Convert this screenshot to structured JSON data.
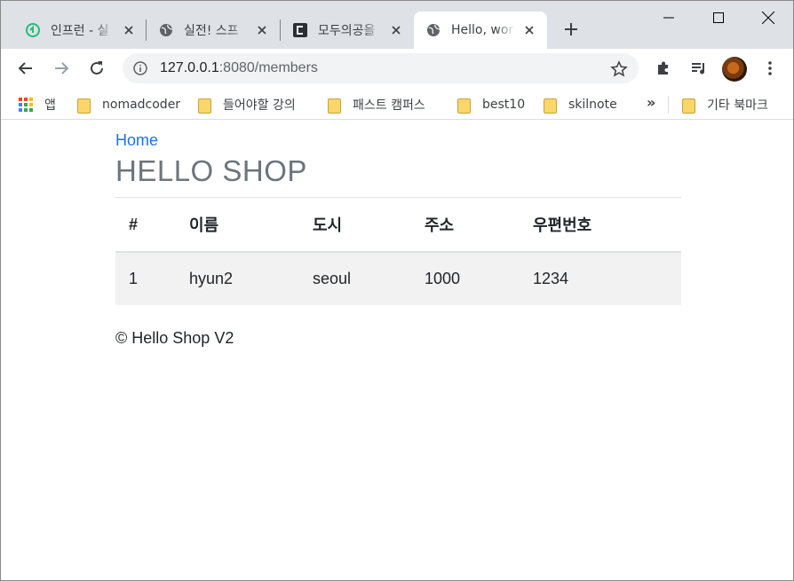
{
  "browser": {
    "tabs": [
      {
        "title": "인프런 - 실",
        "favicon": "inflearn-icon",
        "active": false
      },
      {
        "title": "실전! 스프",
        "favicon": "globe-icon",
        "active": false
      },
      {
        "title": "모두의공을",
        "favicon": "modu-icon",
        "active": false
      },
      {
        "title": "Hello, wor",
        "favicon": "globe-icon",
        "active": true
      }
    ],
    "url_host": "127.0.0.1",
    "url_rest": ":8080/members",
    "bookmarks": {
      "apps_label": "앱",
      "items": [
        "nomadcoder",
        "들어야할 강의",
        "패스트 캠퍼스",
        "best10",
        "skilnote"
      ],
      "more": "»",
      "other": "기타 북마크"
    }
  },
  "page": {
    "home_link": "Home",
    "title": "HELLO SHOP",
    "table": {
      "headers": [
        "#",
        "이름",
        "도시",
        "주소",
        "우편번호"
      ],
      "rows": [
        [
          "1",
          "hyun2",
          "seoul",
          "1000",
          "1234"
        ]
      ]
    },
    "footer": "© Hello Shop V2"
  },
  "colors": {
    "link": "#1a73e8",
    "title": "#6c757d",
    "row_striped": "#f2f2f2",
    "tabstrip": "#dee1e6"
  }
}
